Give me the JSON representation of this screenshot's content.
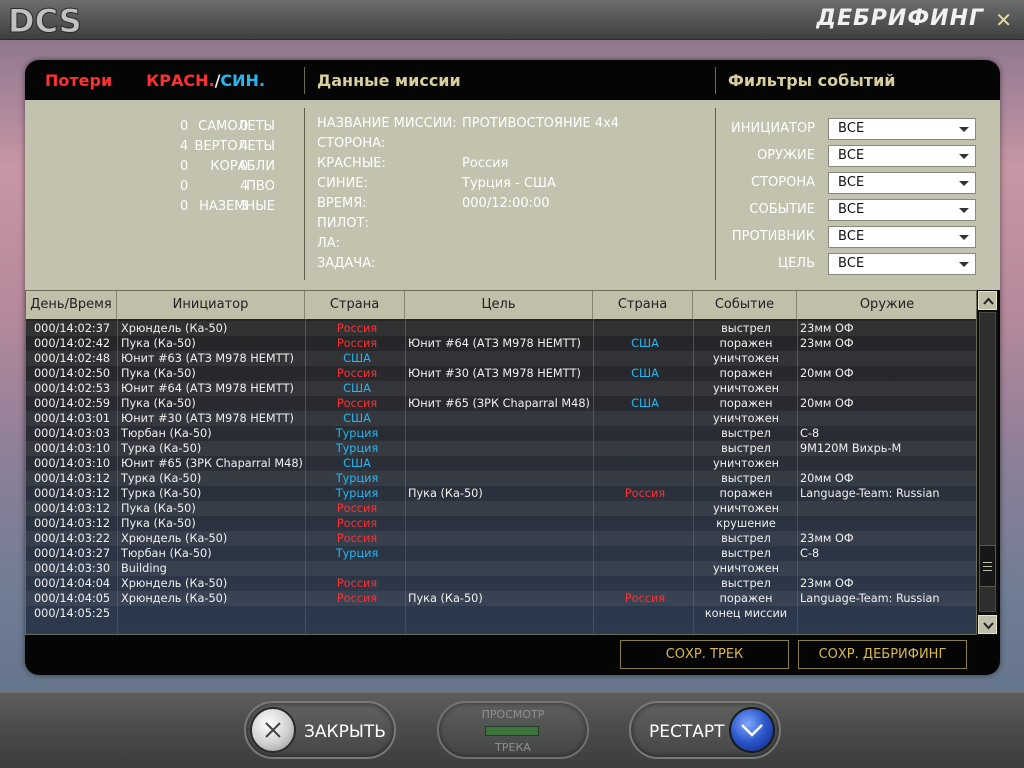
{
  "app": {
    "logo_text": "DCS",
    "title": "ДЕБРИФИНГ",
    "close_glyph": "✕"
  },
  "headers": {
    "losses": "Потери",
    "red": "КРАСН.",
    "slash": "/",
    "blue": "СИН.",
    "mission": "Данные миссии",
    "filters": "Фильтры событий"
  },
  "losses": [
    {
      "label": "САМОЛЕТЫ",
      "red": "0",
      "blue": "0"
    },
    {
      "label": "ВЕРТОЛЕТЫ",
      "red": "4",
      "blue": "4"
    },
    {
      "label": "КОРАБЛИ",
      "red": "0",
      "blue": "0"
    },
    {
      "label": "ПВО",
      "red": "0",
      "blue": "4"
    },
    {
      "label": "НАЗЕМНЫЕ",
      "red": "0",
      "blue": "3"
    }
  ],
  "mission": [
    {
      "label": "НАЗВАНИЕ МИССИИ:",
      "value": "ПРОТИВОСТОЯНИЕ 4х4"
    },
    {
      "label": "СТОРОНА:",
      "value": ""
    },
    {
      "label": "КРАСНЫЕ:",
      "value": "Россия"
    },
    {
      "label": "СИНИЕ:",
      "value": "Турция - США"
    },
    {
      "label": "ВРЕМЯ:",
      "value": "000/12:00:00"
    },
    {
      "label": "ПИЛОТ:",
      "value": ""
    },
    {
      "label": "ЛА:",
      "value": ""
    },
    {
      "label": "ЗАДАЧА:",
      "value": ""
    }
  ],
  "filters": [
    {
      "label": "ИНИЦИАТОР",
      "value": "ВСЕ"
    },
    {
      "label": "ОРУЖИЕ",
      "value": "ВСЕ"
    },
    {
      "label": "СТОРОНА",
      "value": "ВСЕ"
    },
    {
      "label": "СОБЫТИЕ",
      "value": "ВСЕ"
    },
    {
      "label": "ПРОТИВНИК",
      "value": "ВСЕ"
    },
    {
      "label": "ЦЕЛЬ",
      "value": "ВСЕ"
    }
  ],
  "table": {
    "columns": [
      "День/Время",
      "Инициатор",
      "Страна",
      "Цель",
      "Страна",
      "Событие",
      "Оружие"
    ],
    "rows": [
      [
        "000/14:02:37",
        "Хрюндель (Ка-50)",
        "Россия",
        "",
        "",
        "выстрел",
        "23мм ОФ"
      ],
      [
        "000/14:02:42",
        "Пука (Ка-50)",
        "Россия",
        "Юнит #64 (АТЗ М978 НЕМТТ)",
        "США",
        "поражен",
        "23мм ОФ"
      ],
      [
        "000/14:02:48",
        "Юнит #63 (АТЗ М978 НЕМТТ)",
        "США",
        "",
        "",
        "уничтожен",
        ""
      ],
      [
        "000/14:02:50",
        "Пука (Ка-50)",
        "Россия",
        "Юнит #30 (АТЗ М978 НЕМТТ)",
        "США",
        "поражен",
        "20мм ОФ"
      ],
      [
        "000/14:02:53",
        "Юнит #64 (АТЗ М978 НЕМТТ)",
        "США",
        "",
        "",
        "уничтожен",
        ""
      ],
      [
        "000/14:02:59",
        "Пука (Ка-50)",
        "Россия",
        "Юнит #65 (ЗРК Chaparral M48)",
        "США",
        "поражен",
        "20мм ОФ"
      ],
      [
        "000/14:03:01",
        "Юнит #30 (АТЗ М978 НЕМТТ)",
        "США",
        "",
        "",
        "уничтожен",
        ""
      ],
      [
        "000/14:03:03",
        "Тюрбан (Ка-50)",
        "Турция",
        "",
        "",
        "выстрел",
        "С-8"
      ],
      [
        "000/14:03:10",
        "Турка (Ка-50)",
        "Турция",
        "",
        "",
        "выстрел",
        "9М120М Вихрь-М"
      ],
      [
        "000/14:03:10",
        "Юнит #65 (ЗРК Chaparral M48)",
        "США",
        "",
        "",
        "уничтожен",
        ""
      ],
      [
        "000/14:03:12",
        "Турка (Ка-50)",
        "Турция",
        "",
        "",
        "выстрел",
        "20мм ОФ"
      ],
      [
        "000/14:03:12",
        "Турка (Ка-50)",
        "Турция",
        "Пука (Ка-50)",
        "Россия",
        "поражен",
        "Language-Team: Russian"
      ],
      [
        "000/14:03:12",
        "Пука (Ка-50)",
        "Россия",
        "",
        "",
        "уничтожен",
        ""
      ],
      [
        "000/14:03:12",
        "Пука (Ка-50)",
        "Россия",
        "",
        "",
        "крушение",
        ""
      ],
      [
        "000/14:03:22",
        "Хрюндель (Ка-50)",
        "Россия",
        "",
        "",
        "выстрел",
        "23мм ОФ"
      ],
      [
        "000/14:03:27",
        "Тюрбан (Ка-50)",
        "Турция",
        "",
        "",
        "выстрел",
        "С-8"
      ],
      [
        "000/14:03:30",
        "Building",
        "",
        "",
        "",
        "уничтожен",
        ""
      ],
      [
        "000/14:04:04",
        "Хрюндель (Ка-50)",
        "Россия",
        "",
        "",
        "выстрел",
        "23мм ОФ"
      ],
      [
        "000/14:04:05",
        "Хрюндель (Ка-50)",
        "Россия",
        "Пука (Ка-50)",
        "Россия",
        "поражен",
        "Language-Team: Russian"
      ],
      [
        "000/14:05:25",
        "",
        "",
        "",
        "",
        "конец миссии",
        ""
      ]
    ]
  },
  "buttons": {
    "save_track": "СОХР. ТРЕК",
    "save_debrief": "СОХР. ДЕБРИФИНГ",
    "close": "ЗАКРЫТЬ",
    "view_top": "ПРОСМОТР",
    "view_bottom": "ТРЕКА",
    "restart": "РЕСТАРТ"
  },
  "colors": {
    "red_side": "#ff3030",
    "blue_side": "#29b6f0",
    "accent_gold": "#d8b94a",
    "header_tan": "#d8cf9e",
    "info_bg": "#c2c2ae"
  },
  "icons": {
    "close_button": "x-circle-icon",
    "restart_button": "chevron-down-circle-icon",
    "scroll_up": "chevron-up-icon",
    "scroll_down": "chevron-down-icon"
  }
}
